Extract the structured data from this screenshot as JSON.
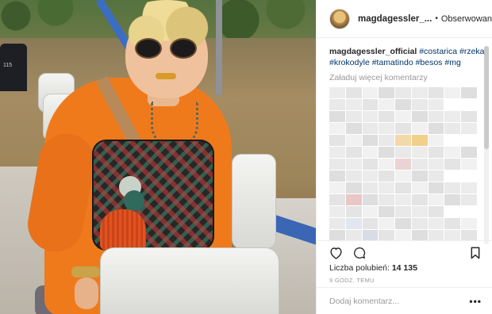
{
  "header": {
    "username": "magdagessler_...",
    "separator": "•",
    "follow_label": "Obserwowanie"
  },
  "caption": {
    "username": "magdagessler_official",
    "hashtags": [
      "#costarica",
      "#rzeka",
      "#krokodyle",
      "#tamatindo",
      "#besos",
      "#mg"
    ]
  },
  "comments": {
    "load_more": "Załaduj więcej komentarzy"
  },
  "actions": {
    "like_icon": "heart-icon",
    "comment_icon": "comment-bubble-icon",
    "save_icon": "bookmark-icon"
  },
  "likes": {
    "label": "Liczba polubień:",
    "count": "14 135"
  },
  "timestamp": "9 GODZ. TEMU",
  "comment_box": {
    "placeholder": "Dodaj komentarz...",
    "more_label": "•••"
  },
  "colors": {
    "hashtag": "#003569",
    "muted": "#999999",
    "border": "#efefef"
  }
}
